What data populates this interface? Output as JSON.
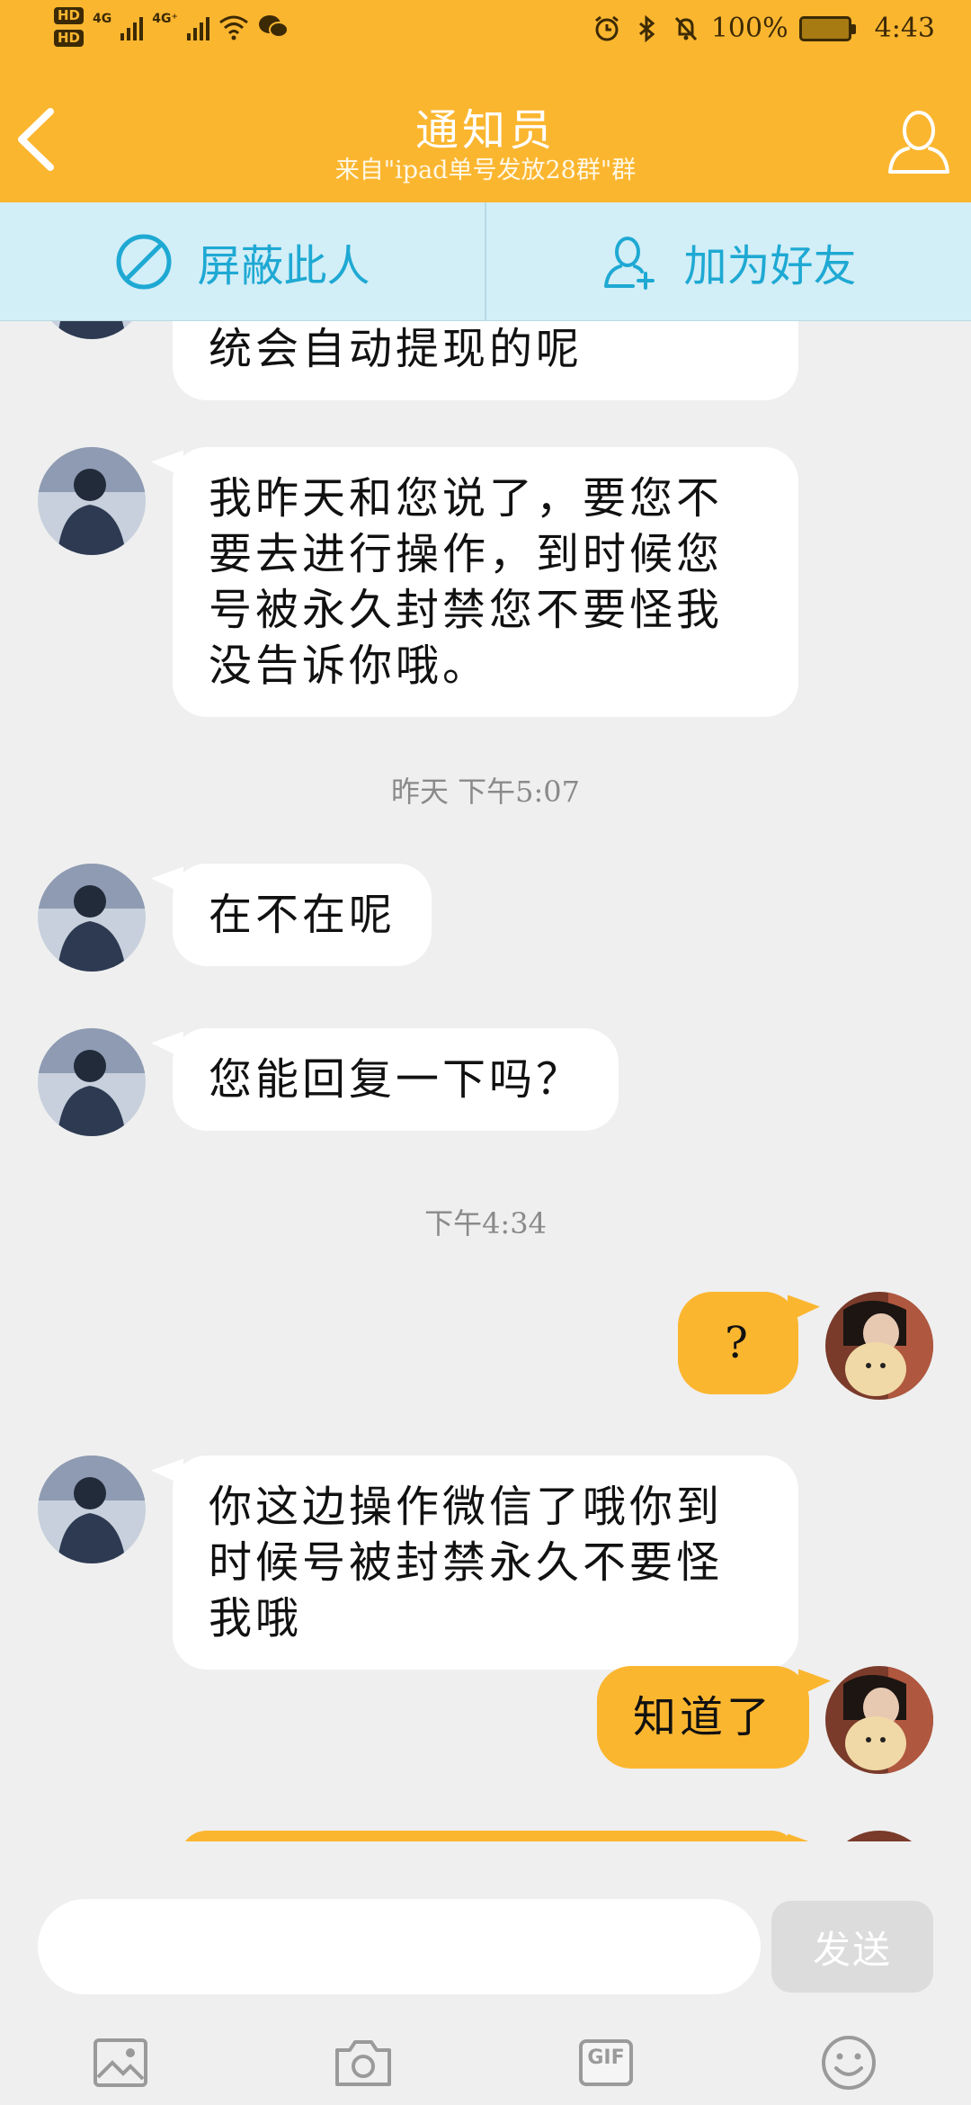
{
  "status_bar": {
    "hd1": "HD",
    "hd2": "HD",
    "net1": "4G",
    "net2": "4G⁺",
    "battery_percent": "100%",
    "time": "4:43"
  },
  "header": {
    "title": "通知员",
    "subtitle": "来自\"ipad单号发放28群\"群"
  },
  "actions": {
    "block_label": "屏蔽此人",
    "add_friend_label": "加为好友"
  },
  "messages": [
    {
      "sender": "other",
      "text": "统会自动提现的呢"
    },
    {
      "sender": "other",
      "text": "我昨天和您说了，要您不要去进行操作，到时候您号被永久封禁您不要怪我没告诉你哦。"
    },
    {
      "type": "time",
      "text": "昨天 下午5:07"
    },
    {
      "sender": "other",
      "text": "在不在呢"
    },
    {
      "sender": "other",
      "text": "您能回复一下吗？"
    },
    {
      "type": "time",
      "text": "下午4:34"
    },
    {
      "sender": "self",
      "text": "?"
    },
    {
      "sender": "other",
      "text": "你这边操作微信了哦你到时候号被封禁永久不要怪我哦"
    },
    {
      "sender": "self",
      "text": "知道了"
    }
  ],
  "input": {
    "placeholder": "",
    "send_label": "发送"
  },
  "toolbar": {
    "gif_label": "GIF"
  },
  "colors": {
    "brand": "#fbb630",
    "action_bar_bg": "#d2eef7",
    "action_text": "#1ea9d3",
    "chat_bg": "#efefef"
  }
}
